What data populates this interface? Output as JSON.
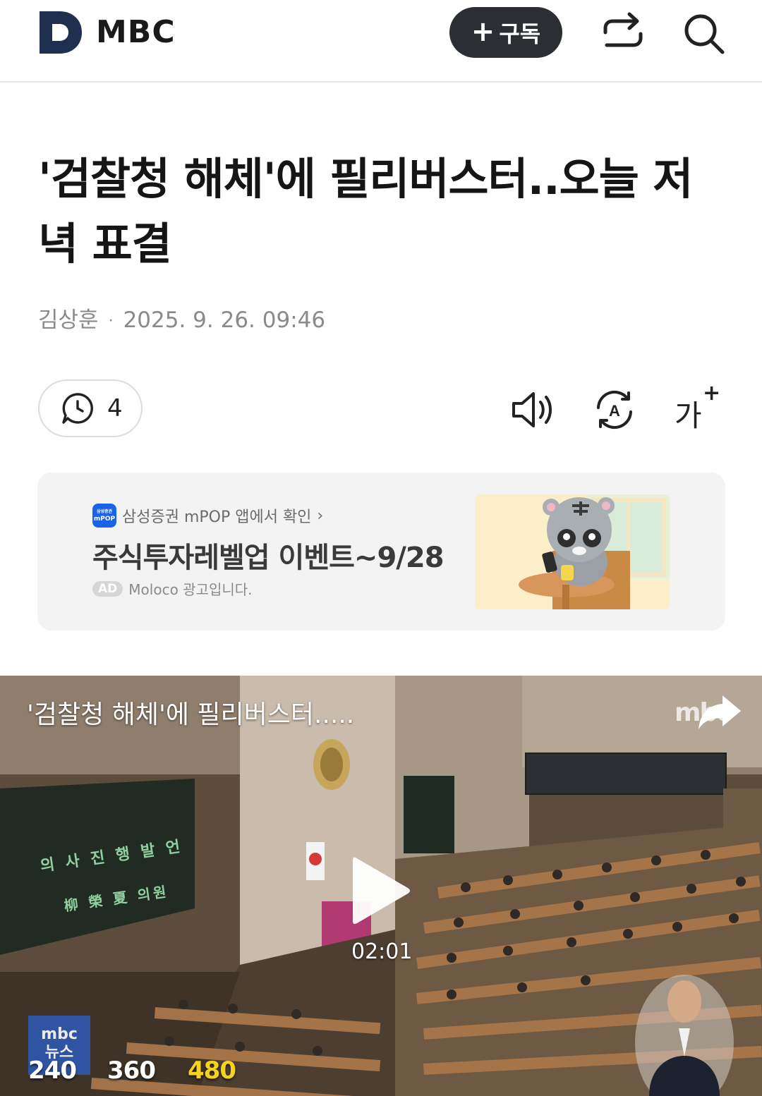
{
  "header": {
    "logo_letter": "D",
    "brand": "MBC",
    "subscribe_plus": "+",
    "subscribe_label": "구독",
    "icons": [
      "d-logo-icon",
      "share-icon",
      "search-icon"
    ]
  },
  "article": {
    "title": "'검찰청 해체'에 필리버스터..오늘 저녁 표결",
    "author": "김상훈",
    "separator": "·",
    "date": "2025. 9. 26. 09:46"
  },
  "actions": {
    "comment_count": "4",
    "icons": [
      "comment-icon",
      "speaker-icon",
      "translate-icon",
      "font-size-icon"
    ],
    "font_size_glyph": "가",
    "font_size_plus": "+",
    "translate_letter": "A"
  },
  "ad": {
    "badge_top": "삼성증권",
    "badge_bottom": "mPOP",
    "source": "삼성증권 mPOP 앱에서 확인",
    "chevron": "›",
    "headline": "주식투자레벨업 이벤트~9/28",
    "tag": "AD",
    "disclaimer": "Moloco 광고입니다."
  },
  "video": {
    "title": "'검찰청 해체'에 필리버스터.....",
    "watermark": "mbc",
    "duration": "02:01",
    "logo_top": "mbc",
    "logo_bottom": "뉴스",
    "board_line1": "의 사 진 행 발 언",
    "board_line2": "柳 榮 夏 의원",
    "quality_options": [
      "240",
      "360",
      "480"
    ],
    "selected_quality": "480",
    "colors": {
      "quality_default": "#ffffff",
      "quality_selected": "#f5d21e"
    }
  }
}
